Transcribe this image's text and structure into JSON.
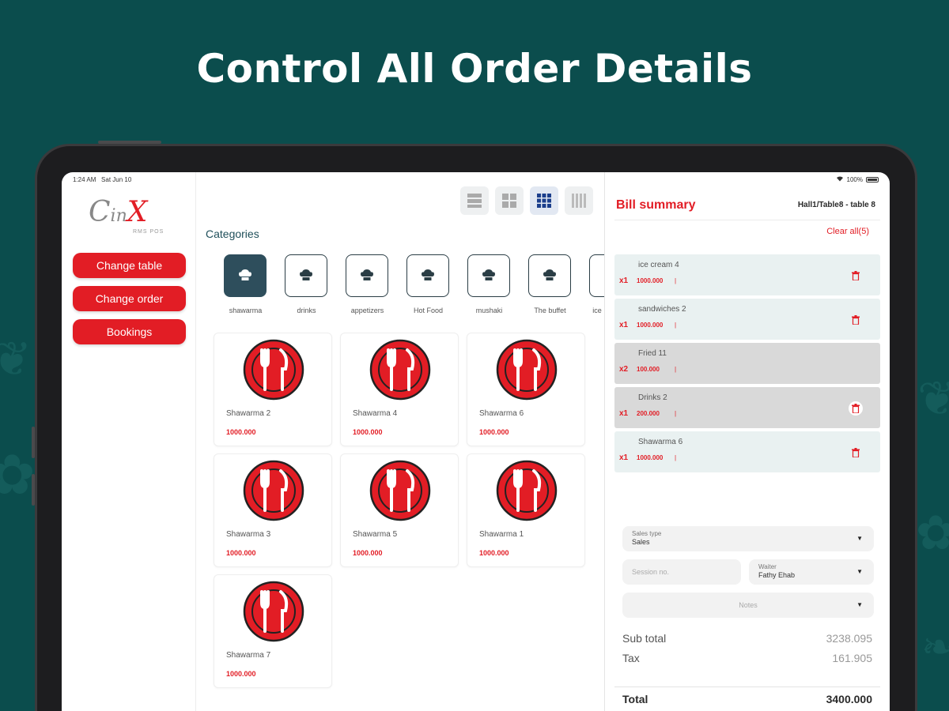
{
  "headline": "Control All Order Details",
  "status_bar": {
    "time": "1:24 AM",
    "date": "Sat Jun 10",
    "battery": "100%"
  },
  "logo": {
    "text": "CinX",
    "sub": "RMS POS"
  },
  "sidebar": {
    "buttons": [
      {
        "label": "Change table"
      },
      {
        "label": "Change order"
      },
      {
        "label": "Bookings"
      }
    ]
  },
  "view_modes": [
    "list-view-icon",
    "grid-2-icon",
    "grid-3-icon",
    "grid-4-icon"
  ],
  "categories": {
    "title": "Categories",
    "items": [
      {
        "label": "shawarma",
        "active": true
      },
      {
        "label": "drinks"
      },
      {
        "label": "appetizers"
      },
      {
        "label": "Hot Food"
      },
      {
        "label": "mushaki"
      },
      {
        "label": "The buffet"
      },
      {
        "label": "ice"
      }
    ]
  },
  "products": [
    {
      "name": "Shawarma 2",
      "price": "1000.000"
    },
    {
      "name": "Shawarma 4",
      "price": "1000.000"
    },
    {
      "name": "Shawarma 6",
      "price": "1000.000"
    },
    {
      "name": "Shawarma 3",
      "price": "1000.000"
    },
    {
      "name": "Shawarma 5",
      "price": "1000.000"
    },
    {
      "name": "Shawarma 1",
      "price": "1000.000"
    },
    {
      "name": "Shawarma 7",
      "price": "1000.000"
    }
  ],
  "bill": {
    "title": "Bill summary",
    "table": "Hall1/Table8 - table 8",
    "clear_all": "Clear all(5)",
    "items": [
      {
        "name": "ice cream 4",
        "qty": "x1",
        "price": "1000.000",
        "bar": "|",
        "highlight": false
      },
      {
        "name": "sandwiches 2",
        "qty": "x1",
        "price": "1000.000",
        "bar": "|",
        "highlight": false
      },
      {
        "name": "Fried 11",
        "qty": "x2",
        "price": "100.000",
        "bar": "|",
        "highlight": true
      },
      {
        "name": "Drinks 2",
        "qty": "x1",
        "price": "200.000",
        "bar": "|",
        "highlight": true
      },
      {
        "name": "Shawarma 6",
        "qty": "x1",
        "price": "1000.000",
        "bar": "|",
        "highlight": false
      }
    ],
    "sales_type": {
      "label": "Sales type",
      "value": "Sales"
    },
    "session": {
      "placeholder": "Session no."
    },
    "waiter": {
      "label": "Waiter",
      "value": "Fathy Ehab"
    },
    "notes": {
      "placeholder": "Notes"
    },
    "subtotal": {
      "label": "Sub total",
      "value": "3238.095"
    },
    "tax": {
      "label": "Tax",
      "value": "161.905"
    },
    "total": {
      "label": "Total",
      "value": "3400.000"
    }
  },
  "colors": {
    "accent": "#e21d25",
    "background": "#0b4d4d",
    "category_active": "#2e4e5c",
    "item_bg": "#e9f1f1",
    "item_highlight_bg": "#d9d9d9"
  }
}
